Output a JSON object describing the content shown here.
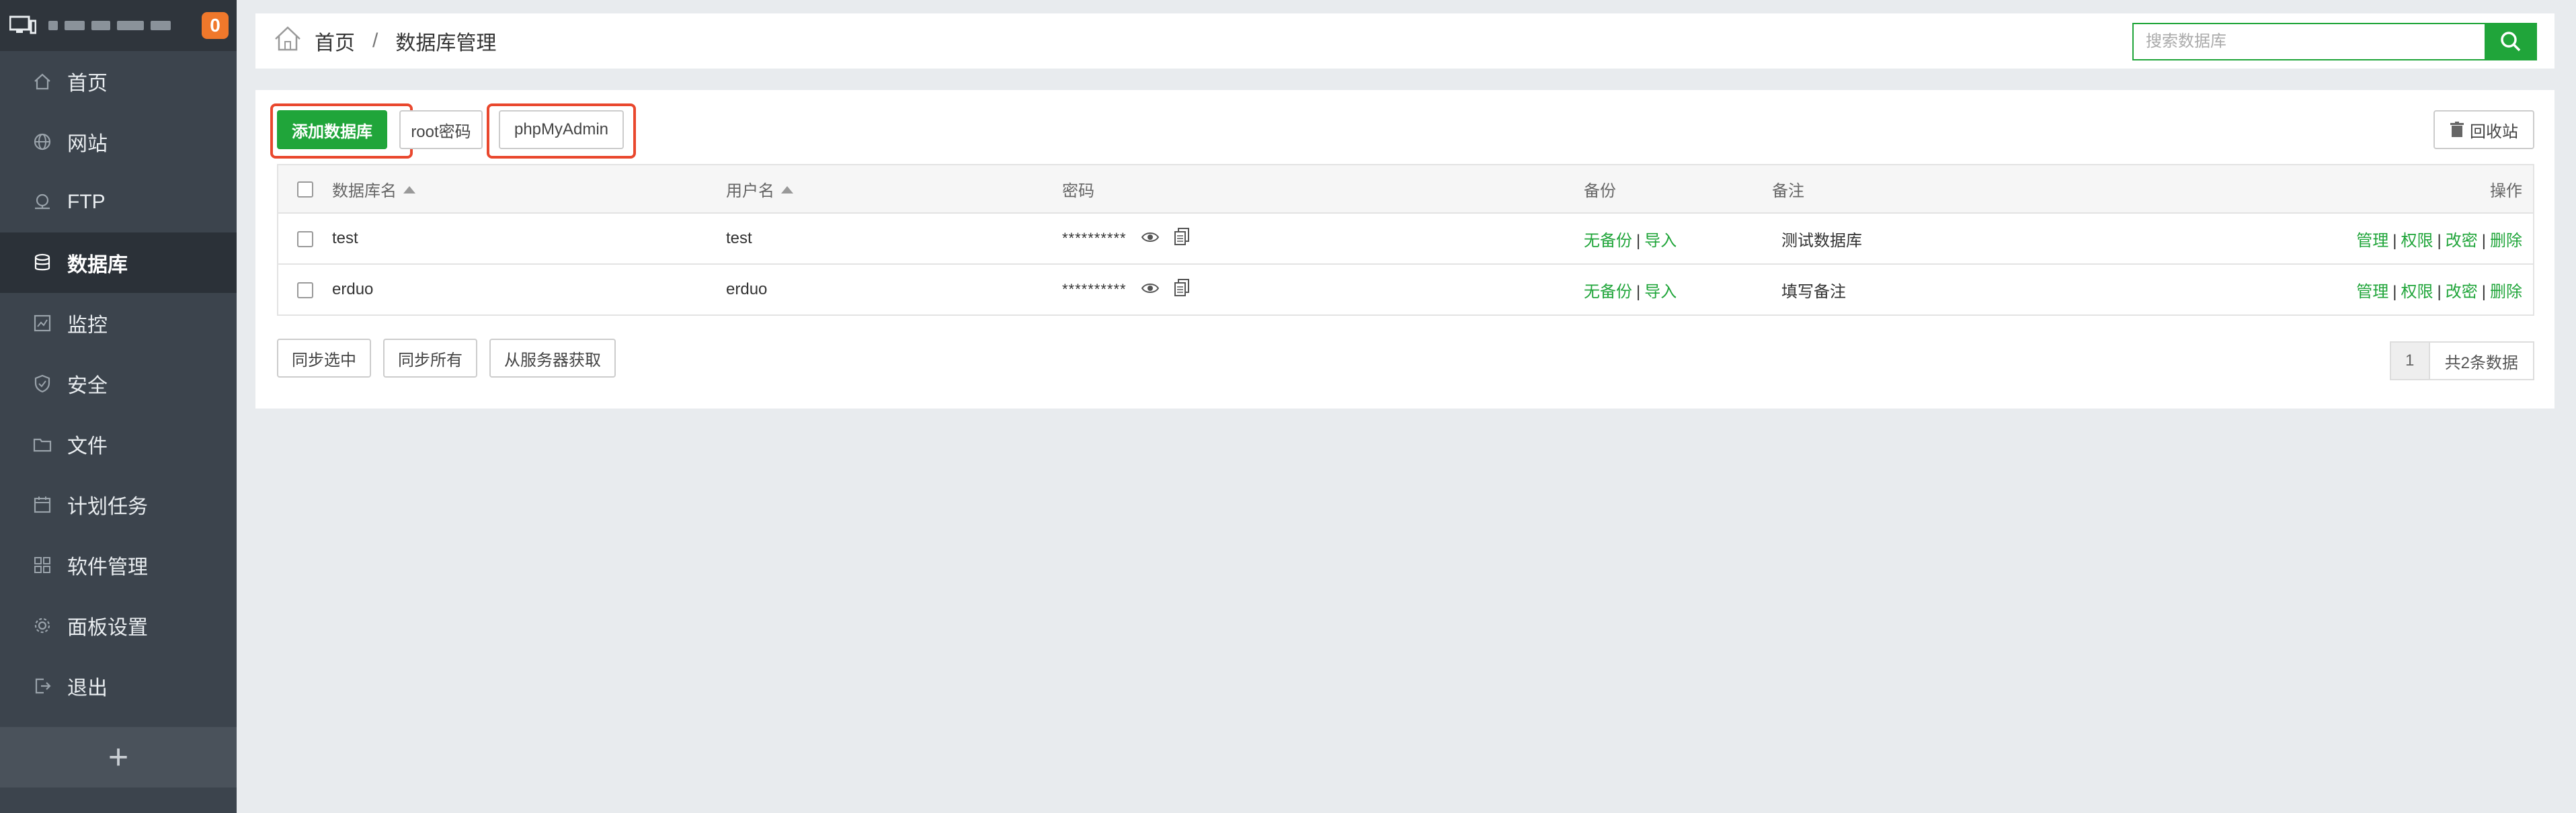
{
  "sidebar": {
    "notification_count": "0",
    "items": [
      {
        "label": "首页",
        "icon": "home-icon"
      },
      {
        "label": "网站",
        "icon": "globe-icon"
      },
      {
        "label": "FTP",
        "icon": "ftp-icon"
      },
      {
        "label": "数据库",
        "icon": "database-icon",
        "active": true
      },
      {
        "label": "监控",
        "icon": "monitor-icon"
      },
      {
        "label": "安全",
        "icon": "shield-icon"
      },
      {
        "label": "文件",
        "icon": "folder-icon"
      },
      {
        "label": "计划任务",
        "icon": "calendar-icon"
      },
      {
        "label": "软件管理",
        "icon": "apps-icon"
      },
      {
        "label": "面板设置",
        "icon": "gear-icon"
      },
      {
        "label": "退出",
        "icon": "logout-icon"
      }
    ],
    "add_label": "+"
  },
  "breadcrumb": {
    "home": "首页",
    "separator": "/",
    "current": "数据库管理"
  },
  "search": {
    "placeholder": "搜索数据库"
  },
  "toolbar": {
    "add_db": "添加数据库",
    "root_password": "root密码",
    "phpmyadmin": "phpMyAdmin",
    "recycle": "回收站"
  },
  "table": {
    "headers": {
      "name": "数据库名",
      "user": "用户名",
      "password": "密码",
      "backup": "备份",
      "note": "备注",
      "actions": "操作"
    },
    "rows": [
      {
        "name": "test",
        "user": "test",
        "password": "**********",
        "backup_status": "无备份",
        "import": "导入",
        "note": "测试数据库"
      },
      {
        "name": "erduo",
        "user": "erduo",
        "password": "**********",
        "backup_status": "无备份",
        "import": "导入",
        "note": "填写备注"
      }
    ],
    "row_actions": {
      "manage": "管理",
      "permission": "权限",
      "change_password": "改密",
      "delete": "删除"
    }
  },
  "footer": {
    "sync_selected": "同步选中",
    "sync_all": "同步所有",
    "fetch_server": "从服务器获取",
    "page": "1",
    "total": "共2条数据"
  },
  "colors": {
    "accent": "#20a53a",
    "sidebar": "#3c444d",
    "highlight": "#e9472d",
    "badge": "#f0782b"
  }
}
